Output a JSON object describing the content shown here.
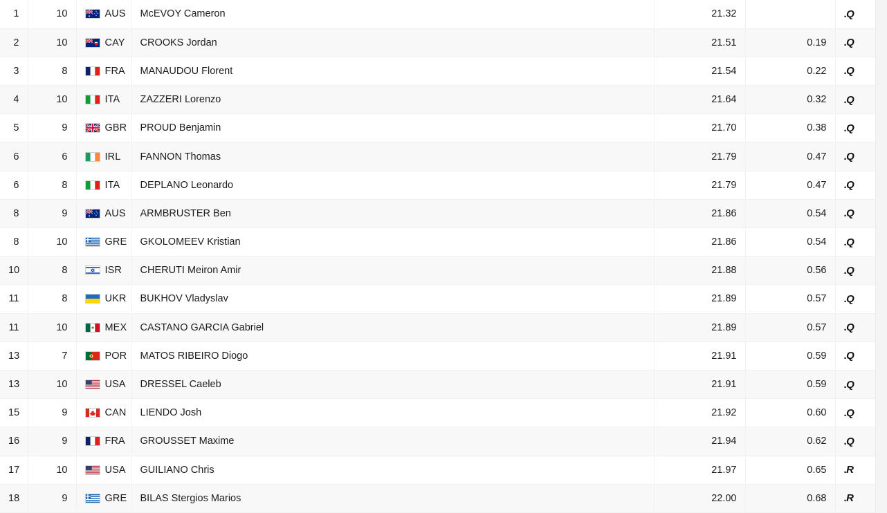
{
  "table": {
    "columns": [
      "rank",
      "lane",
      "nat",
      "name",
      "time",
      "gap",
      "mark"
    ],
    "rows": [
      {
        "rank": "1",
        "lane": "10",
        "nat": "AUS",
        "flag": "AUS",
        "name": "McEVOY Cameron",
        "time": "21.32",
        "gap": "",
        "mark": "Q"
      },
      {
        "rank": "2",
        "lane": "10",
        "nat": "CAY",
        "flag": "CAY",
        "name": "CROOKS Jordan",
        "time": "21.51",
        "gap": "0.19",
        "mark": "Q"
      },
      {
        "rank": "3",
        "lane": "8",
        "nat": "FRA",
        "flag": "FRA",
        "name": "MANAUDOU Florent",
        "time": "21.54",
        "gap": "0.22",
        "mark": "Q"
      },
      {
        "rank": "4",
        "lane": "10",
        "nat": "ITA",
        "flag": "ITA",
        "name": "ZAZZERI Lorenzo",
        "time": "21.64",
        "gap": "0.32",
        "mark": "Q"
      },
      {
        "rank": "5",
        "lane": "9",
        "nat": "GBR",
        "flag": "GBR",
        "name": "PROUD Benjamin",
        "time": "21.70",
        "gap": "0.38",
        "mark": "Q"
      },
      {
        "rank": "6",
        "lane": "6",
        "nat": "IRL",
        "flag": "IRL",
        "name": "FANNON Thomas",
        "time": "21.79",
        "gap": "0.47",
        "mark": "Q"
      },
      {
        "rank": "6",
        "lane": "8",
        "nat": "ITA",
        "flag": "ITA",
        "name": "DEPLANO Leonardo",
        "time": "21.79",
        "gap": "0.47",
        "mark": "Q"
      },
      {
        "rank": "8",
        "lane": "9",
        "nat": "AUS",
        "flag": "AUS",
        "name": "ARMBRUSTER Ben",
        "time": "21.86",
        "gap": "0.54",
        "mark": "Q"
      },
      {
        "rank": "8",
        "lane": "10",
        "nat": "GRE",
        "flag": "GRE",
        "name": "GKOLOMEEV Kristian",
        "time": "21.86",
        "gap": "0.54",
        "mark": "Q"
      },
      {
        "rank": "10",
        "lane": "8",
        "nat": "ISR",
        "flag": "ISR",
        "name": "CHERUTI Meiron Amir",
        "time": "21.88",
        "gap": "0.56",
        "mark": "Q"
      },
      {
        "rank": "11",
        "lane": "8",
        "nat": "UKR",
        "flag": "UKR",
        "name": "BUKHOV Vladyslav",
        "time": "21.89",
        "gap": "0.57",
        "mark": "Q"
      },
      {
        "rank": "11",
        "lane": "10",
        "nat": "MEX",
        "flag": "MEX",
        "name": "CASTANO GARCIA Gabriel",
        "time": "21.89",
        "gap": "0.57",
        "mark": "Q"
      },
      {
        "rank": "13",
        "lane": "7",
        "nat": "POR",
        "flag": "POR",
        "name": "MATOS RIBEIRO Diogo",
        "time": "21.91",
        "gap": "0.59",
        "mark": "Q"
      },
      {
        "rank": "13",
        "lane": "10",
        "nat": "USA",
        "flag": "USA",
        "name": "DRESSEL Caeleb",
        "time": "21.91",
        "gap": "0.59",
        "mark": "Q"
      },
      {
        "rank": "15",
        "lane": "9",
        "nat": "CAN",
        "flag": "CAN",
        "name": "LIENDO Josh",
        "time": "21.92",
        "gap": "0.60",
        "mark": "Q"
      },
      {
        "rank": "16",
        "lane": "9",
        "nat": "FRA",
        "flag": "FRA",
        "name": "GROUSSET Maxime",
        "time": "21.94",
        "gap": "0.62",
        "mark": "Q"
      },
      {
        "rank": "17",
        "lane": "10",
        "nat": "USA",
        "flag": "USA",
        "name": "GUILIANO Chris",
        "time": "21.97",
        "gap": "0.65",
        "mark": "R"
      },
      {
        "rank": "18",
        "lane": "9",
        "nat": "GRE",
        "flag": "GRE",
        "name": "BILAS Stergios Marios",
        "time": "22.00",
        "gap": "0.68",
        "mark": "R"
      }
    ]
  },
  "style": {
    "row_odd_bg": "#ffffff",
    "row_even_bg": "#f8f8f8",
    "text_color": "#1c1c1c",
    "divider": "#f1f1f1",
    "gutter_bg": "#f4f4f4"
  }
}
